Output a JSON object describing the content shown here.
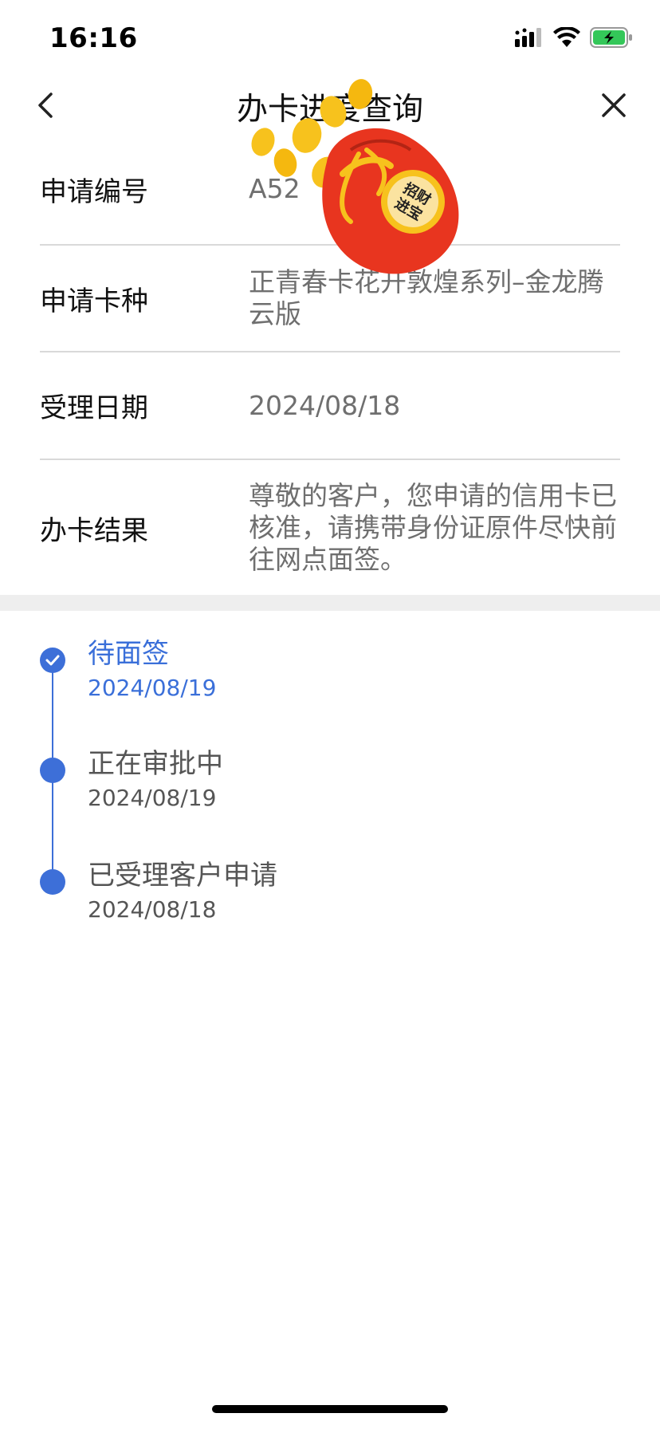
{
  "status_bar": {
    "time": "16:16"
  },
  "nav": {
    "title": "办卡进度查询"
  },
  "info": [
    {
      "label": "申请编号",
      "value": "A52"
    },
    {
      "label": "申请卡种",
      "value": "正青春卡花开敦煌系列–金龙腾云版"
    },
    {
      "label": "受理日期",
      "value": "2024/08/18"
    },
    {
      "label": "办卡结果",
      "value": "尊敬的客户，您申请的信用卡已核准，请携带身份证原件尽快前往网点面签。"
    }
  ],
  "timeline": [
    {
      "title": "待面签",
      "date": "2024/08/19",
      "state": "current"
    },
    {
      "title": "正在审批中",
      "date": "2024/08/19",
      "state": "done"
    },
    {
      "title": "已受理客户申请",
      "date": "2024/08/18",
      "state": "done"
    }
  ],
  "decoration": {
    "bag_text": "招财进宝",
    "bag_icon": "fortune-bag-icon"
  },
  "colors": {
    "accent": "#3a6fd9",
    "bag_red": "#e8351f",
    "gold": "#f7c21d"
  }
}
